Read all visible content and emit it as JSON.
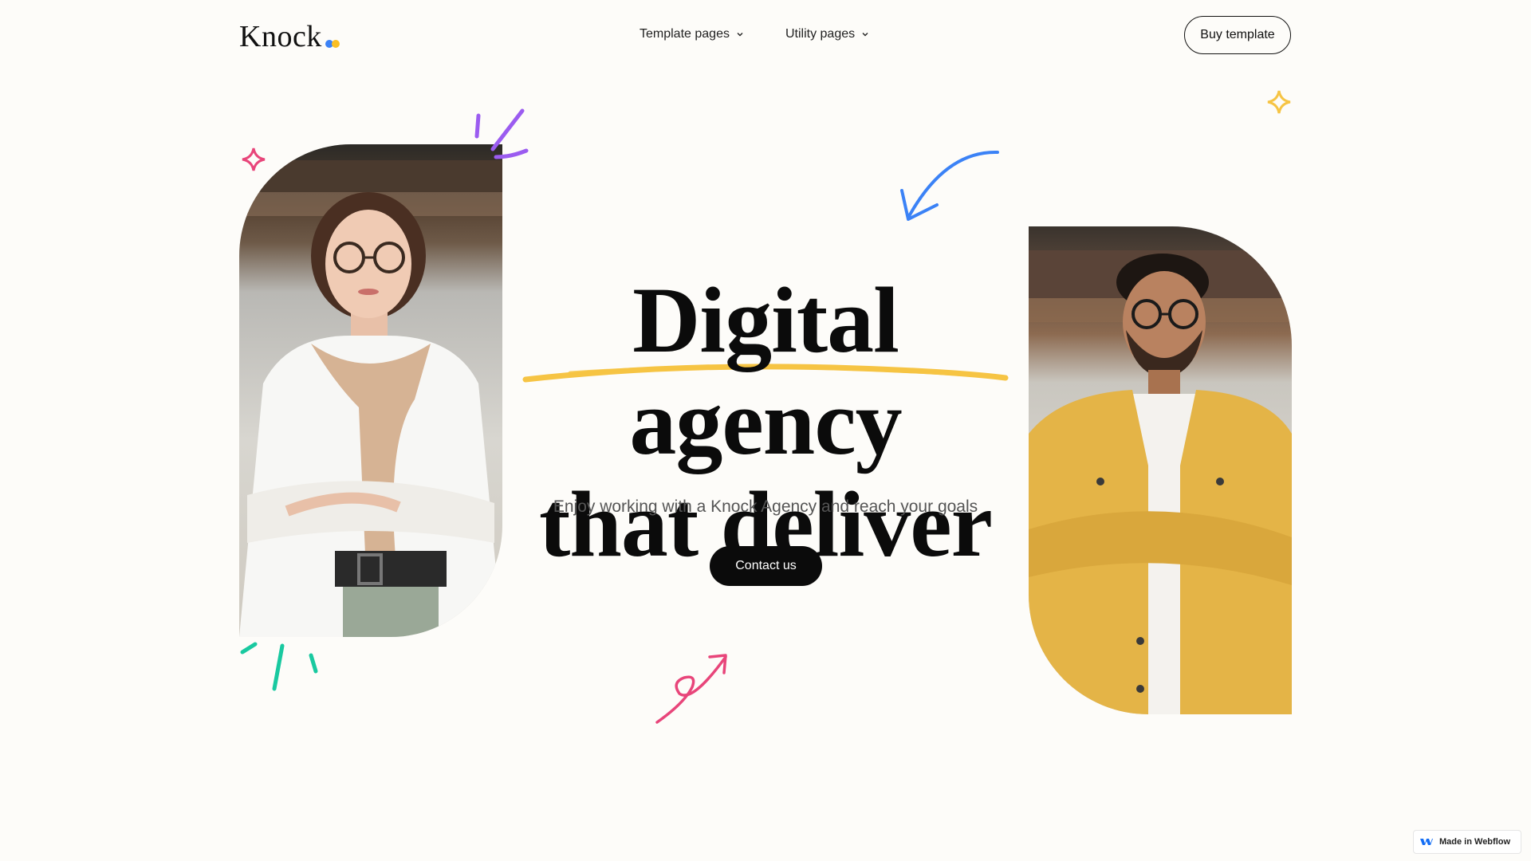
{
  "brand": {
    "logo_text": "Knock"
  },
  "nav": {
    "items": [
      {
        "label": "Template pages"
      },
      {
        "label": "Utility pages"
      }
    ],
    "cta_label": "Buy template"
  },
  "hero": {
    "headline_line1": "Digital agency",
    "headline_line2": "that deliver",
    "subtitle": "Enjoy working with a Knock Agency and reach your goals",
    "cta_label": "Contact us"
  },
  "badge": {
    "label": "Made in Webflow"
  },
  "colors": {
    "background": "#fdfcf9",
    "accent_yellow": "#f6c444",
    "accent_blue": "#3b82f6",
    "accent_pink": "#e8457a",
    "accent_purple": "#9b5cf0",
    "accent_green": "#19c9a0",
    "button_dark": "#0b0b0b"
  }
}
